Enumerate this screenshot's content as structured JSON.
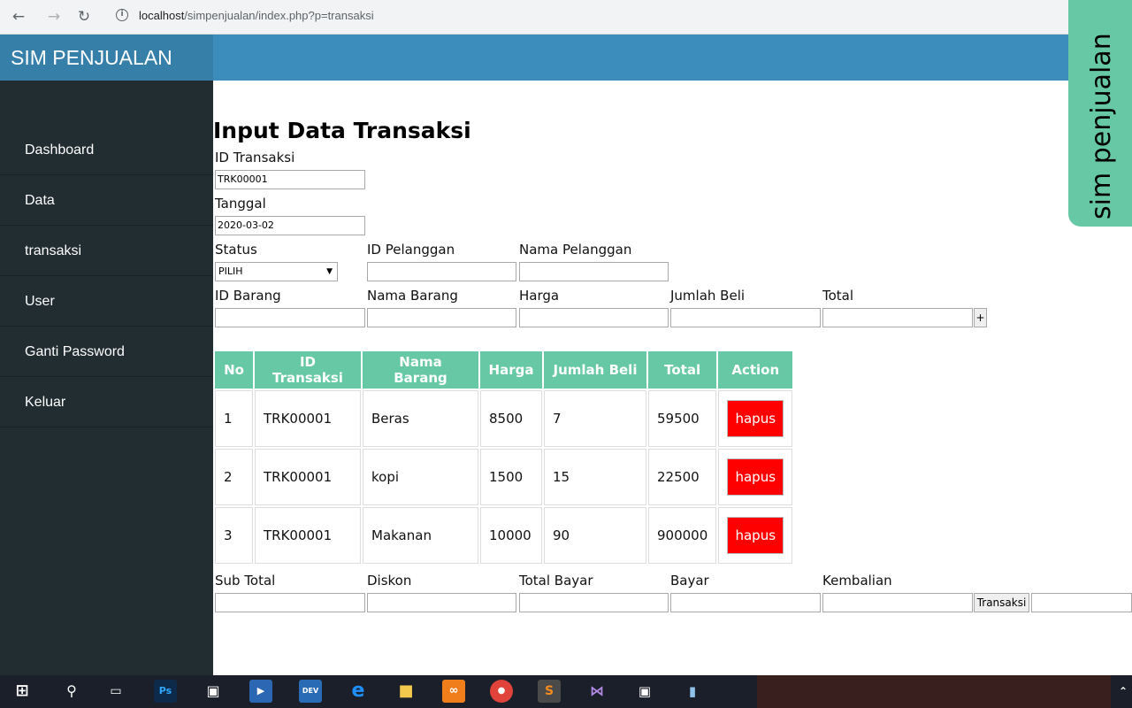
{
  "browser": {
    "url_host": "localhost",
    "url_path": "/simpenjualan/index.php?p=transaksi"
  },
  "brand": "SIM PENJUALAN",
  "sidebar": {
    "items": [
      {
        "label": "Dashboard"
      },
      {
        "label": "Data"
      },
      {
        "label": "transaksi"
      },
      {
        "label": "User"
      },
      {
        "label": "Ganti Password"
      },
      {
        "label": "Keluar"
      }
    ]
  },
  "form": {
    "title": "Input Data Transaksi",
    "id_transaksi_label": "ID Transaksi",
    "id_transaksi_value": "TRK00001",
    "tanggal_label": "Tanggal",
    "tanggal_value": "2020-03-02",
    "status_label": "Status",
    "status_value": "PILIH",
    "id_pelanggan_label": "ID Pelanggan",
    "nama_pelanggan_label": "Nama Pelanggan",
    "id_barang_label": "ID Barang",
    "nama_barang_label": "Nama Barang",
    "harga_label": "Harga",
    "jumlah_beli_label": "Jumlah Beli",
    "total_label": "Total",
    "add_button": "+"
  },
  "table": {
    "headers": [
      "No",
      "ID Transaksi",
      "Nama Barang",
      "Harga",
      "Jumlah Beli",
      "Total",
      "Action"
    ],
    "rows": [
      {
        "no": "1",
        "id": "TRK00001",
        "nama": "Beras",
        "harga": "8500",
        "jumlah": "7",
        "total": "59500",
        "action": "hapus"
      },
      {
        "no": "2",
        "id": "TRK00001",
        "nama": "kopi",
        "harga": "1500",
        "jumlah": "15",
        "total": "22500",
        "action": "hapus"
      },
      {
        "no": "3",
        "id": "TRK00001",
        "nama": "Makanan",
        "harga": "10000",
        "jumlah": "90",
        "total": "900000",
        "action": "hapus"
      }
    ]
  },
  "summary": {
    "sub_total_label": "Sub Total",
    "diskon_label": "Diskon",
    "total_bayar_label": "Total Bayar",
    "bayar_label": "Bayar",
    "kembalian_label": "Kembalian",
    "transaksi_button": "Transaksi"
  },
  "side_tab": "sim penjualan",
  "colors": {
    "header": "#3c8dbc",
    "sidebar": "#222d32",
    "table_header": "#66c8a5",
    "delete_button": "#ff0000"
  }
}
